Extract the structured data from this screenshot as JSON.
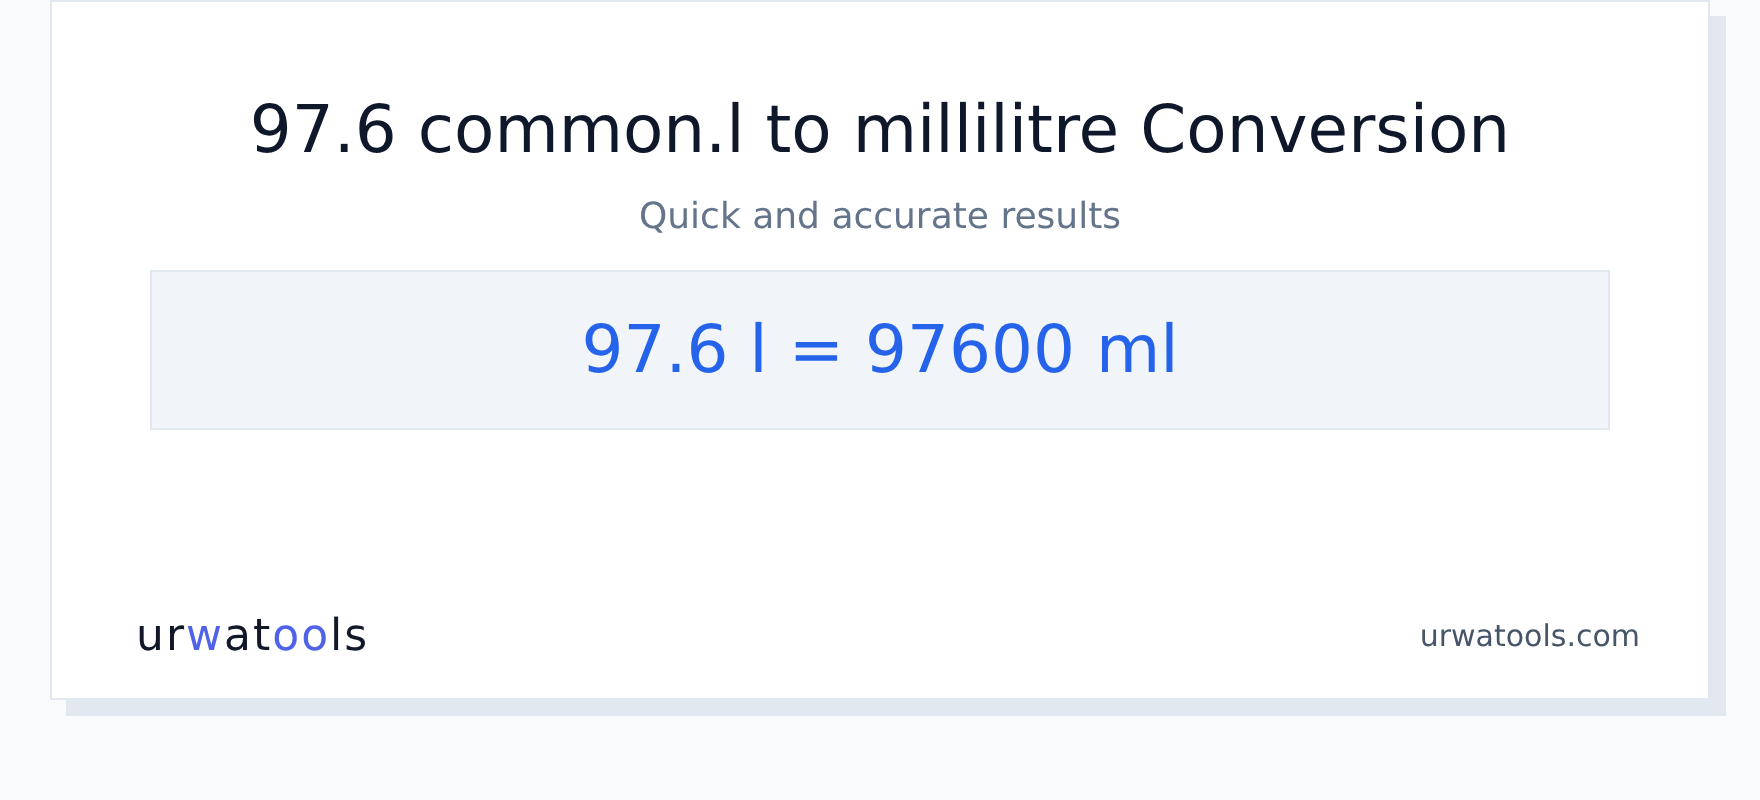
{
  "title": "97.6 common.l to millilitre Conversion",
  "subtitle": "Quick and accurate results",
  "result": "97.6 l = 97600 ml",
  "logo": [
    {
      "text": "ur",
      "accent": false
    },
    {
      "text": "w",
      "accent": true
    },
    {
      "text": "at",
      "accent": false
    },
    {
      "text": "oo",
      "accent": true
    },
    {
      "text": "ls",
      "accent": false
    }
  ],
  "site": "urwatools.com"
}
